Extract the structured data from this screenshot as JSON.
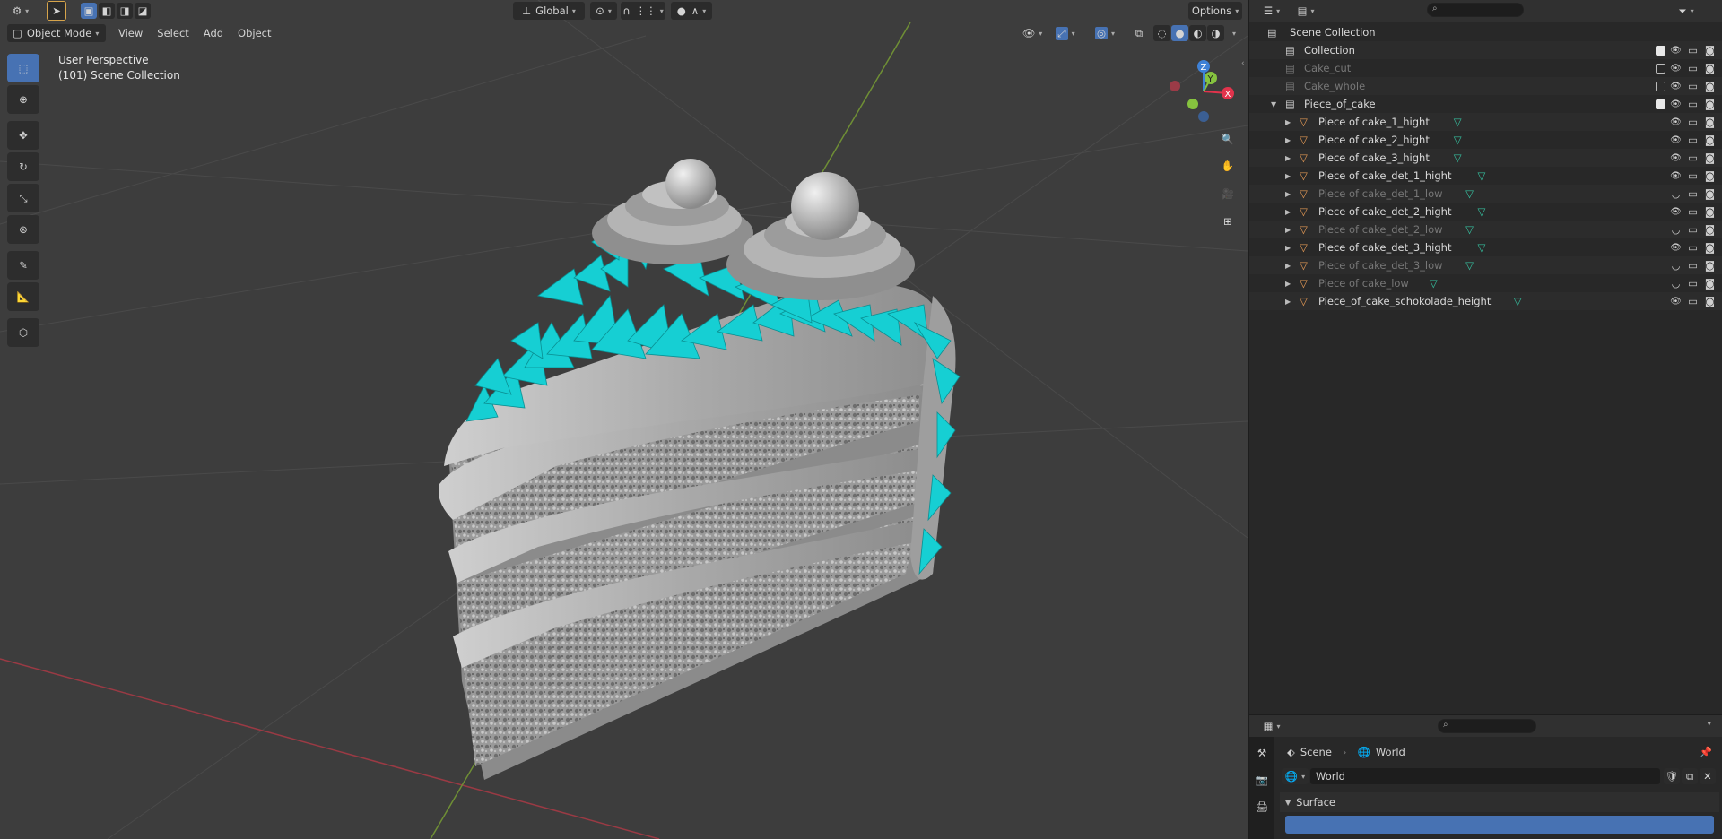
{
  "viewport": {
    "header": {
      "transform_orientation": "Global",
      "options_label": "Options",
      "mode_label": "Object Mode",
      "menus": [
        "View",
        "Select",
        "Add",
        "Object"
      ]
    },
    "overlay": {
      "perspective_label": "User Perspective",
      "collection_label": "(101) Scene Collection"
    },
    "gizmo": {
      "z": "Z",
      "y": "Y",
      "x": "X"
    },
    "tools": [
      "select-box-icon",
      "cursor-icon",
      "move-icon",
      "rotate-icon",
      "scale-icon",
      "transform-icon",
      "annotate-icon",
      "measure-icon",
      "add-cube-icon"
    ],
    "nav_buttons": [
      "zoom-icon",
      "pan-hand-icon",
      "camera-icon",
      "ortho-grid-icon"
    ]
  },
  "outliner": {
    "root_label": "Scene Collection",
    "rows": [
      {
        "label": "Collection",
        "level": 1,
        "kind": "collection",
        "dim": false,
        "checked": true,
        "visible": true,
        "expand": ""
      },
      {
        "label": "Cake_cut",
        "level": 1,
        "kind": "collection",
        "dim": true,
        "checked": false,
        "visible": true,
        "expand": ""
      },
      {
        "label": "Cake_whole",
        "level": 1,
        "kind": "collection",
        "dim": true,
        "checked": false,
        "visible": true,
        "expand": ""
      },
      {
        "label": "Piece_of_cake",
        "level": 1,
        "kind": "collection",
        "dim": false,
        "checked": true,
        "visible": true,
        "expand": "open"
      },
      {
        "label": "Piece of cake_1_hight",
        "level": 2,
        "kind": "object",
        "dim": false,
        "checked": null,
        "visible": true,
        "expand": "closed"
      },
      {
        "label": "Piece of cake_2_hight",
        "level": 2,
        "kind": "object",
        "dim": false,
        "checked": null,
        "visible": true,
        "expand": "closed"
      },
      {
        "label": "Piece of cake_3_hight",
        "level": 2,
        "kind": "object",
        "dim": false,
        "checked": null,
        "visible": true,
        "expand": "closed"
      },
      {
        "label": "Piece of cake_det_1_hight",
        "level": 2,
        "kind": "object",
        "dim": false,
        "checked": null,
        "visible": true,
        "expand": "closed"
      },
      {
        "label": "Piece of cake_det_1_low",
        "level": 2,
        "kind": "object",
        "dim": true,
        "checked": null,
        "visible": false,
        "expand": "closed"
      },
      {
        "label": "Piece of cake_det_2_hight",
        "level": 2,
        "kind": "object",
        "dim": false,
        "checked": null,
        "visible": true,
        "expand": "closed"
      },
      {
        "label": "Piece of cake_det_2_low",
        "level": 2,
        "kind": "object",
        "dim": true,
        "checked": null,
        "visible": false,
        "expand": "closed"
      },
      {
        "label": "Piece of cake_det_3_hight",
        "level": 2,
        "kind": "object",
        "dim": false,
        "checked": null,
        "visible": true,
        "expand": "closed"
      },
      {
        "label": "Piece of cake_det_3_low",
        "level": 2,
        "kind": "object",
        "dim": true,
        "checked": null,
        "visible": false,
        "expand": "closed"
      },
      {
        "label": "Piece of cake_low",
        "level": 2,
        "kind": "object",
        "dim": true,
        "checked": null,
        "visible": false,
        "expand": "closed"
      },
      {
        "label": "Piece_of_cake_schokolade_height",
        "level": 2,
        "kind": "object",
        "dim": false,
        "checked": null,
        "visible": true,
        "expand": "closed"
      }
    ]
  },
  "properties": {
    "breadcrumb_scene": "Scene",
    "breadcrumb_world": "World",
    "world_field": "World",
    "surface_panel": "Surface",
    "tabs": [
      "tool-icon",
      "render-icon",
      "output-icon",
      "view-layer-icon"
    ]
  },
  "colors": {
    "viewport_bg": "#3d3d3d",
    "accent": "#4772b3",
    "object_icon": "#e59a55",
    "mesh_icon": "#36c2a1",
    "frosting": "#16cfd3",
    "x_axis": "#e2334c",
    "y_axis": "#86c33f",
    "z_axis": "#3e81d6"
  }
}
